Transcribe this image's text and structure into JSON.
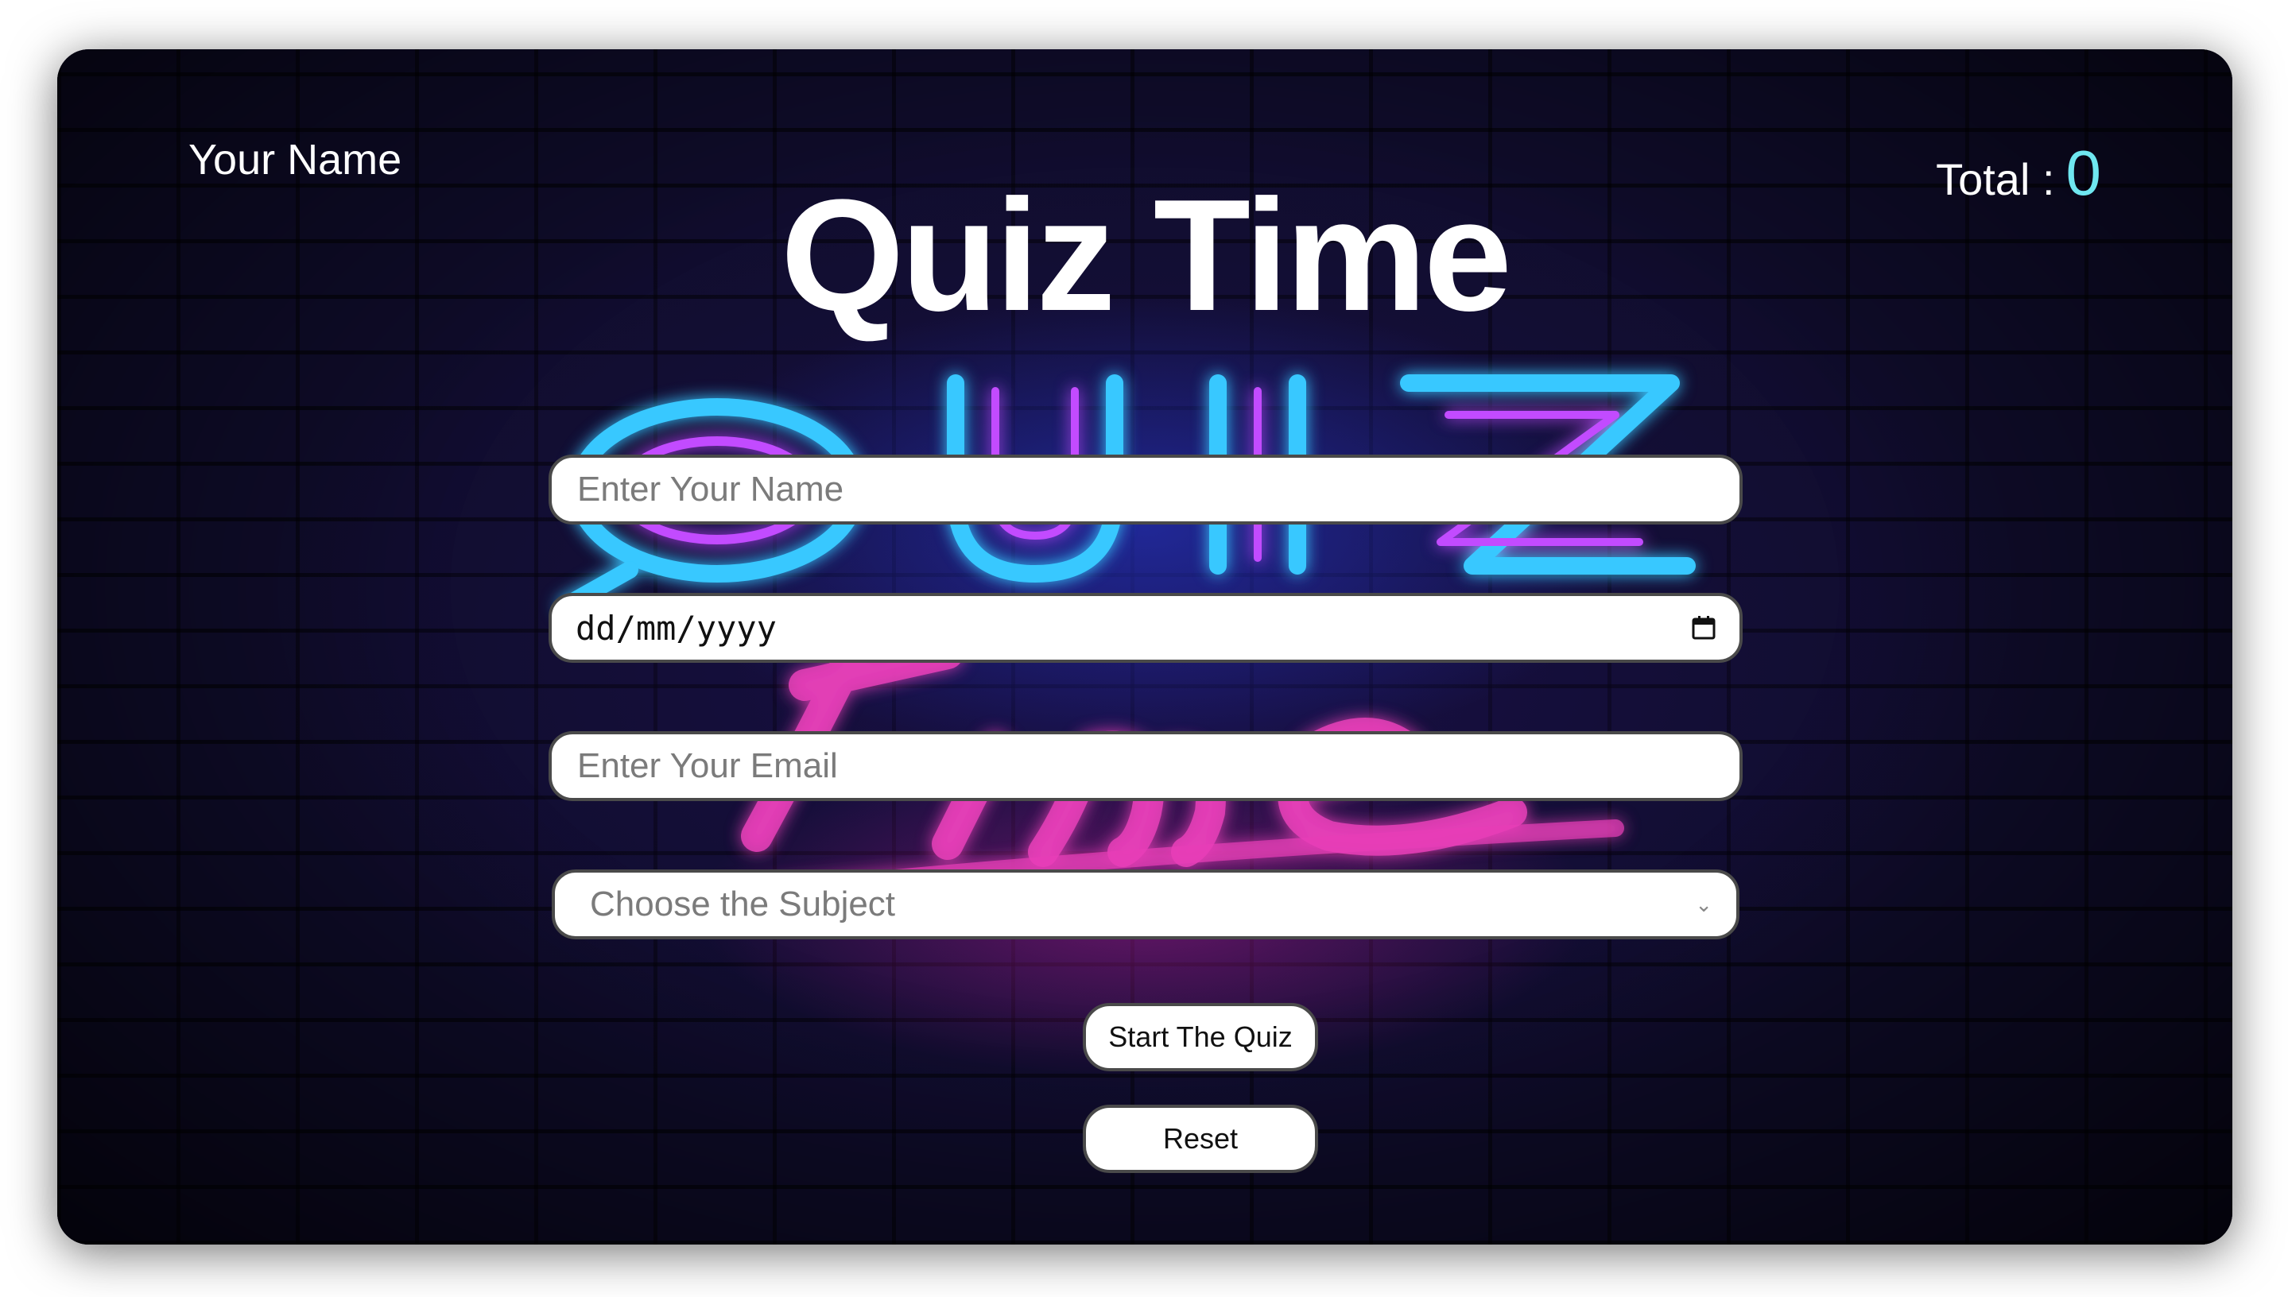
{
  "header": {
    "user_name": "Your Name",
    "title": "Quiz Time",
    "total_label": "Total :",
    "total_value": "0"
  },
  "form": {
    "name_placeholder": "Enter Your Name",
    "date_placeholder": "dd/mm/yyyy",
    "email_placeholder": "Enter Your Email",
    "subject_placeholder": "Choose the Subject"
  },
  "buttons": {
    "start_label": "Start The Quiz",
    "reset_label": "Reset"
  },
  "colors": {
    "accent_total": "#6fe7f0",
    "neon_blue": "#4fd3ff",
    "neon_pink": "#e83fb8"
  },
  "icons": {
    "calendar": "calendar-icon",
    "select_arrow": "chevron-down-icon"
  }
}
